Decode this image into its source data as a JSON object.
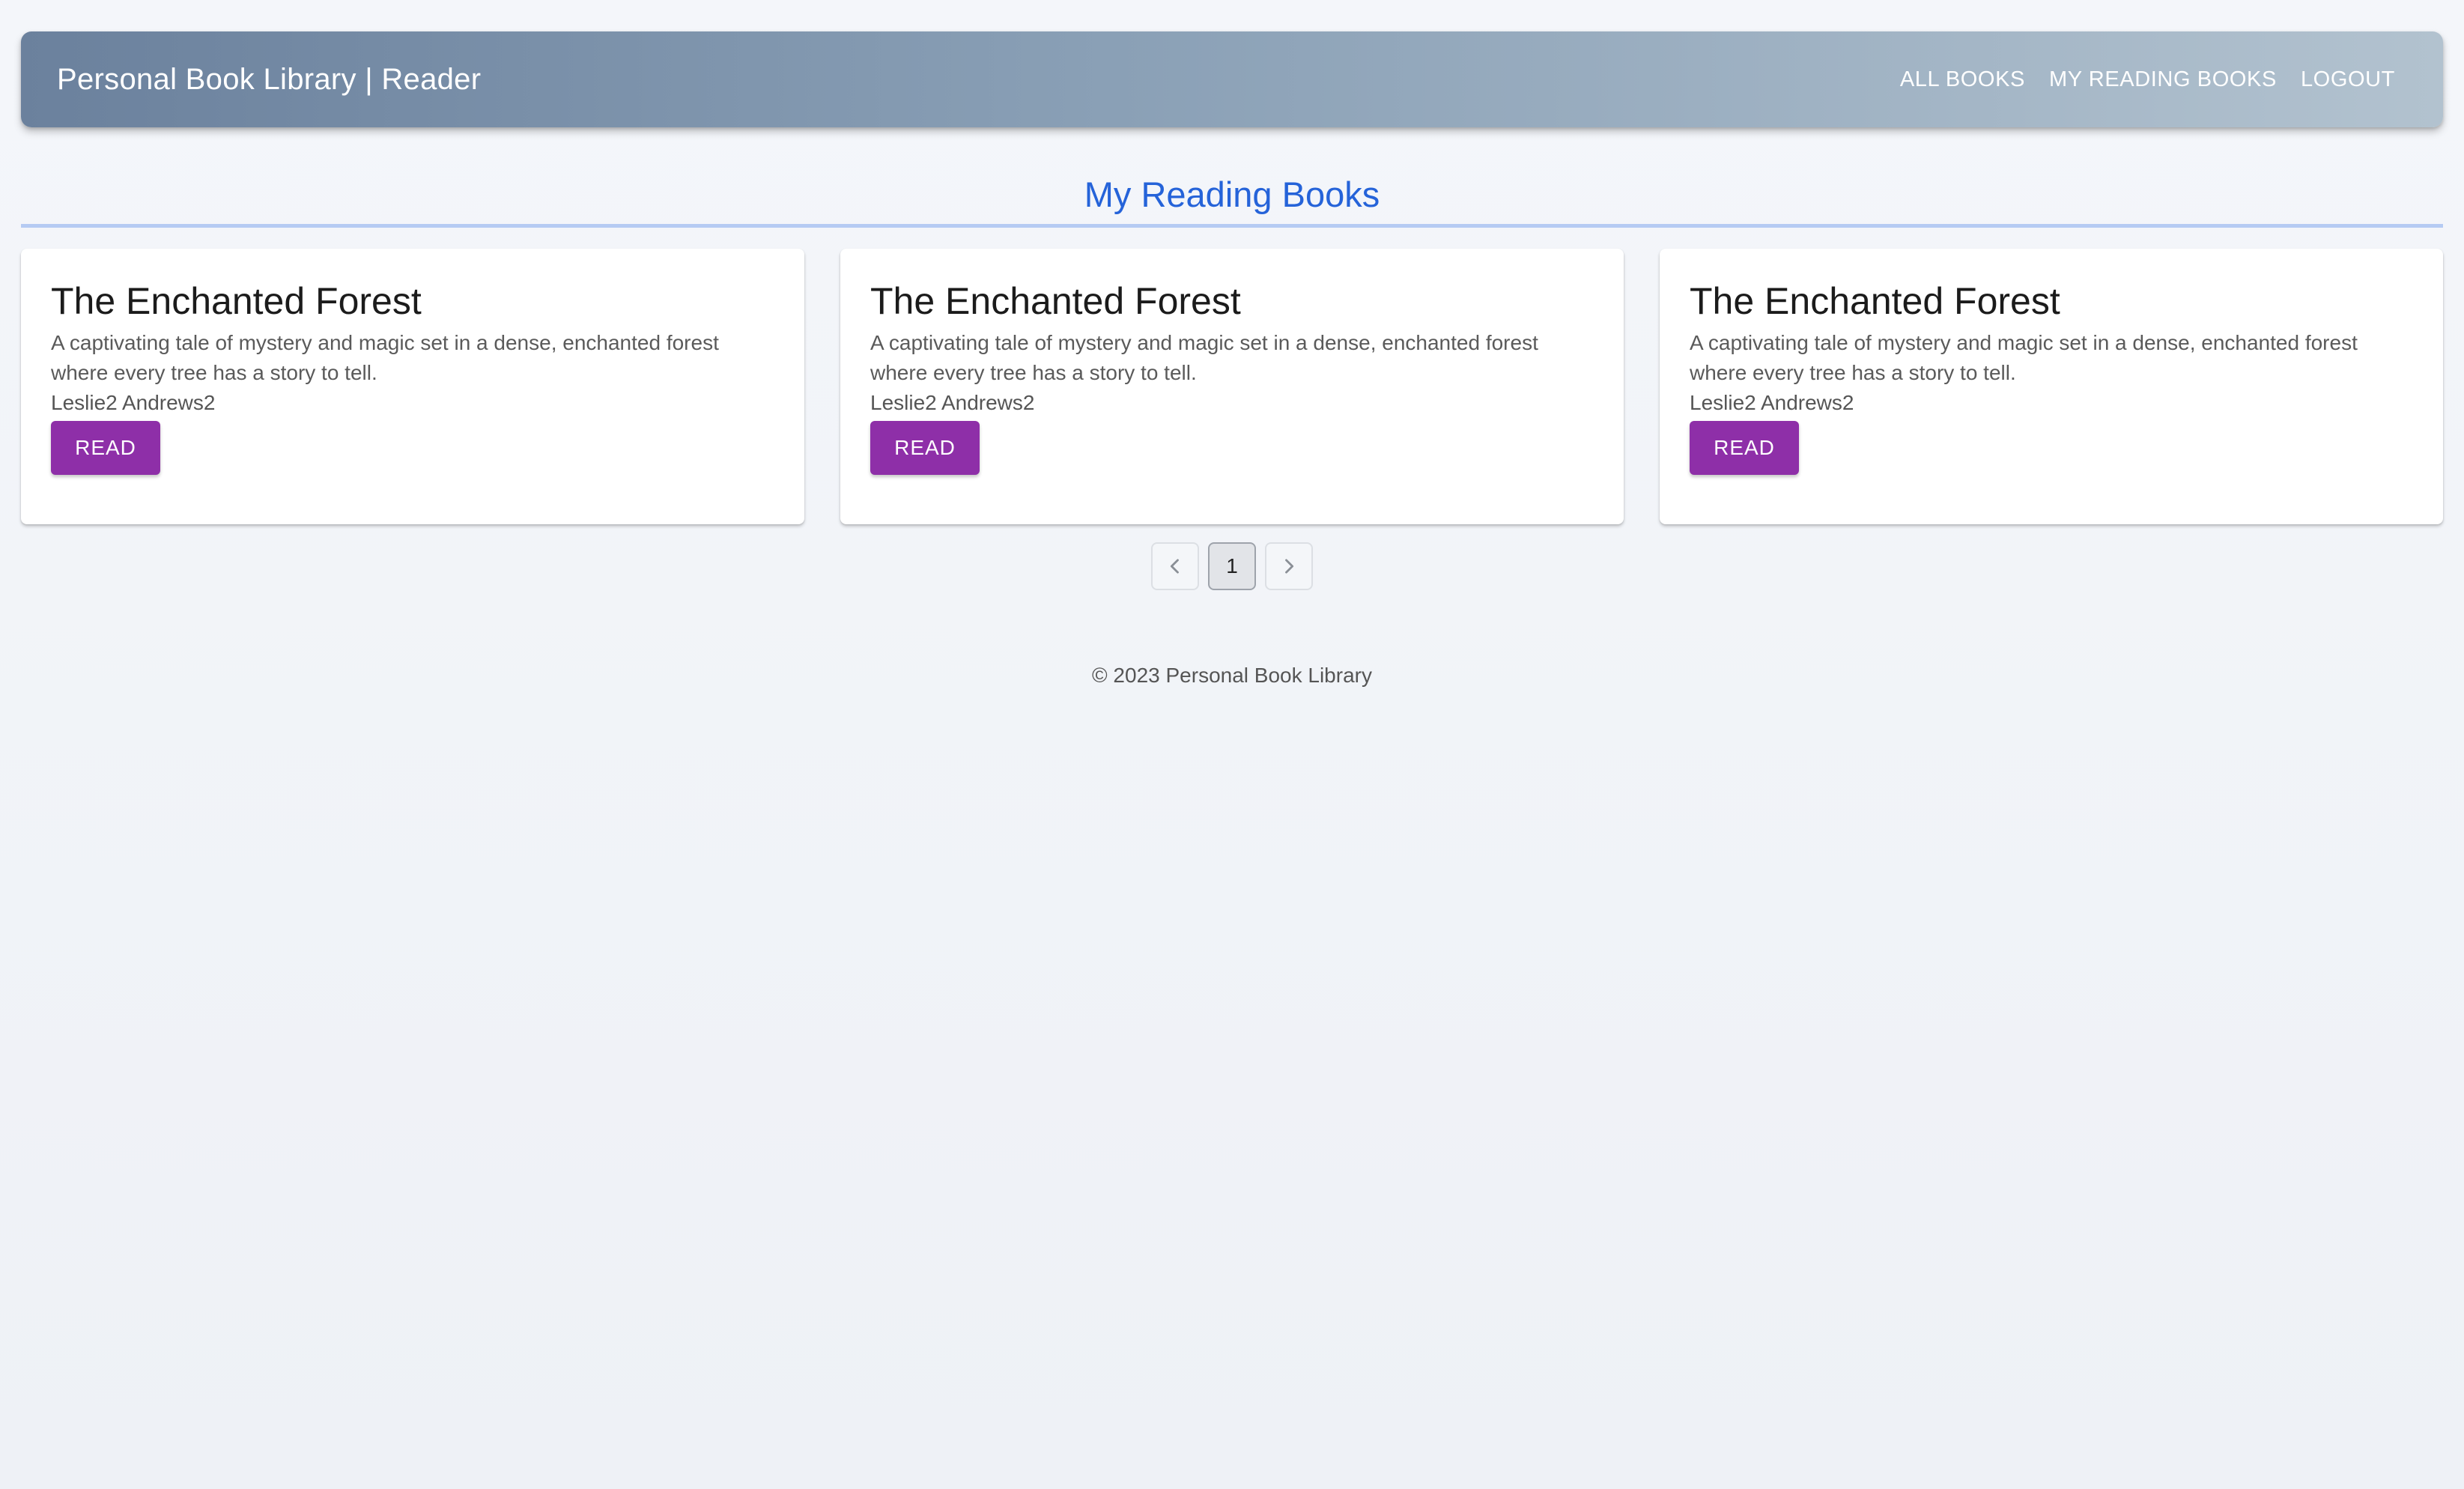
{
  "header": {
    "brand": "Personal Book Library | Reader",
    "nav": [
      {
        "label": "ALL BOOKS"
      },
      {
        "label": "MY READING BOOKS"
      },
      {
        "label": "LOGOUT"
      }
    ]
  },
  "page": {
    "title": "My Reading Books"
  },
  "books": [
    {
      "title": "The Enchanted Forest",
      "description": "A captivating tale of mystery and magic set in a dense, enchanted forest where every tree has a story to tell.",
      "author": "Leslie2 Andrews2",
      "button_label": "READ"
    },
    {
      "title": "The Enchanted Forest",
      "description": "A captivating tale of mystery and magic set in a dense, enchanted forest where every tree has a story to tell.",
      "author": "Leslie2 Andrews2",
      "button_label": "READ"
    },
    {
      "title": "The Enchanted Forest",
      "description": "A captivating tale of mystery and magic set in a dense, enchanted forest where every tree has a story to tell.",
      "author": "Leslie2 Andrews2",
      "button_label": "READ"
    }
  ],
  "pagination": {
    "current_page": "1",
    "prev_icon": "chevron-left-icon",
    "next_icon": "chevron-right-icon"
  },
  "footer": {
    "text": "© 2023 Personal Book Library"
  },
  "colors": {
    "accent": "#2563d9",
    "button": "#8e2fa8",
    "header_start": "#6b819d",
    "header_end": "#b2c2cf"
  }
}
